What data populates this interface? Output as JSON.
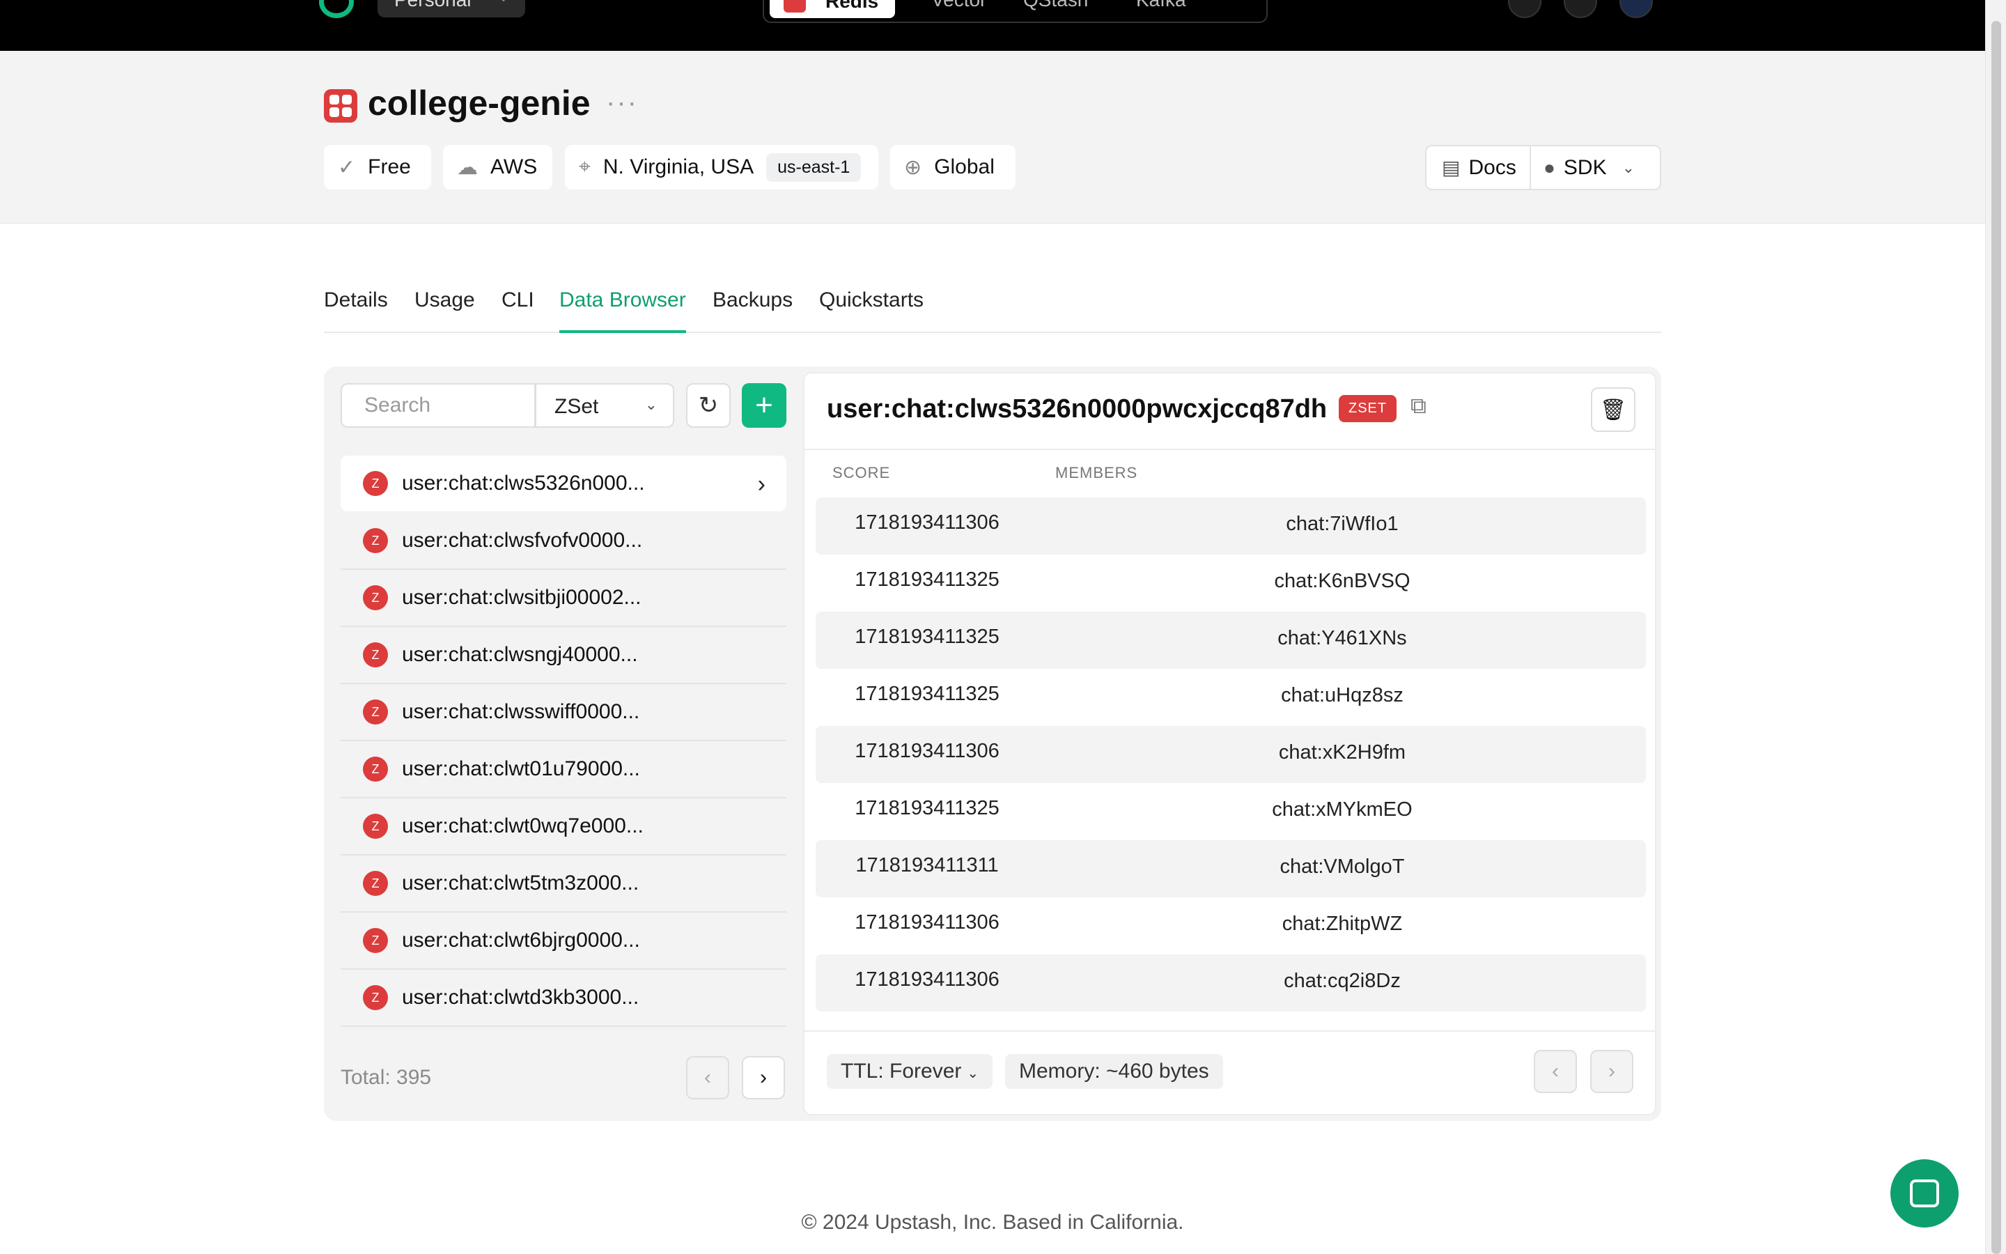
{
  "topbar": {
    "workspace": "Personal",
    "products": [
      "Redis",
      "Vector",
      "QStash",
      "Kafka"
    ]
  },
  "database": {
    "name": "college-genie",
    "more": "···",
    "chips": {
      "plan": "Free",
      "cloud": "AWS",
      "region": "N. Virginia, USA",
      "region_code": "us-east-1",
      "type": "Global"
    },
    "links": {
      "docs": "Docs",
      "sdk": "SDK"
    }
  },
  "tabs": [
    "Details",
    "Usage",
    "CLI",
    "Data Browser",
    "Backups",
    "Quickstarts"
  ],
  "active_tab": "Data Browser",
  "browser": {
    "search_placeholder": "Search",
    "type_filter": "ZSet",
    "keys": [
      "user:chat:clws5326n000...",
      "user:chat:clwsfvofv0000...",
      "user:chat:clwsitbji00002...",
      "user:chat:clwsngj40000...",
      "user:chat:clwsswiff0000...",
      "user:chat:clwt01u79000...",
      "user:chat:clwt0wq7e000...",
      "user:chat:clwt5tm3z000...",
      "user:chat:clwt6bjrg0000...",
      "user:chat:clwtd3kb3000..."
    ],
    "key_badge": "Z",
    "total": "Total: 395"
  },
  "detail": {
    "key": "user:chat:clws5326n0000pwcxjccq87dh",
    "type_badge": "ZSET",
    "columns": {
      "score": "SCORE",
      "members": "MEMBERS"
    },
    "entries": [
      {
        "score": "1718193411306",
        "member": "chat:7iWfIo1"
      },
      {
        "score": "1718193411325",
        "member": "chat:K6nBVSQ"
      },
      {
        "score": "1718193411325",
        "member": "chat:Y461XNs"
      },
      {
        "score": "1718193411325",
        "member": "chat:uHqz8sz"
      },
      {
        "score": "1718193411306",
        "member": "chat:xK2H9fm"
      },
      {
        "score": "1718193411325",
        "member": "chat:xMYkmEO"
      },
      {
        "score": "1718193411311",
        "member": "chat:VMolgoT"
      },
      {
        "score": "1718193411306",
        "member": "chat:ZhitpWZ"
      },
      {
        "score": "1718193411306",
        "member": "chat:cq2i8Dz"
      }
    ],
    "ttl": "TTL: Forever",
    "memory": "Memory: ~460 bytes"
  },
  "footer": "© 2024 Upstash, Inc. Based in California.",
  "colors": {
    "accent": "#10b981",
    "redis": "#dc3c3c"
  }
}
